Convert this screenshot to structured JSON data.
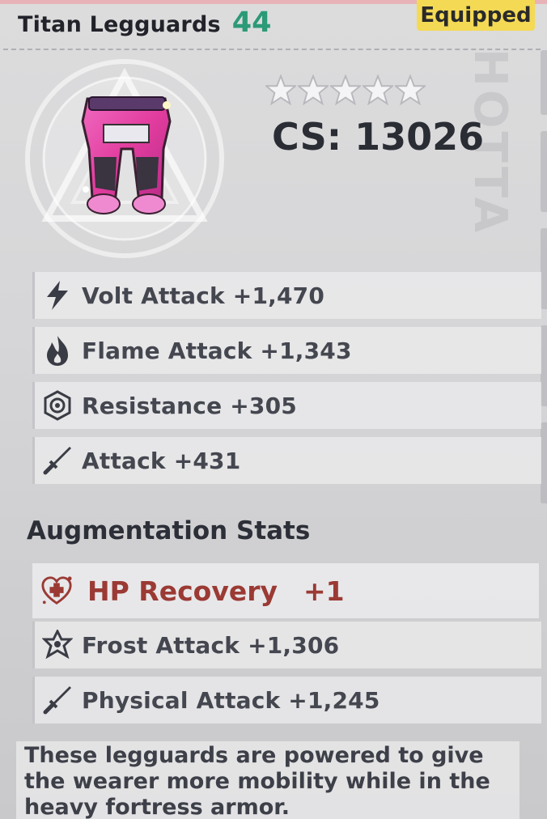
{
  "item": {
    "name": "Titan Legguards",
    "level": "44",
    "status": "Equipped"
  },
  "rating": {
    "stars_total": 5,
    "stars_filled": 0,
    "cs": "CS: 13026"
  },
  "base_stats": [
    {
      "icon": "volt-icon",
      "label": "Volt Attack +1,470"
    },
    {
      "icon": "flame-icon",
      "label": "Flame Attack +1,343"
    },
    {
      "icon": "resistance-icon",
      "label": "Resistance +305"
    },
    {
      "icon": "sword-icon",
      "label": "Attack +431"
    }
  ],
  "augmentation": {
    "title": "Augmentation Stats",
    "highlight": {
      "icon": "heart-plus-icon",
      "label": "HP Recovery",
      "value": "+1"
    },
    "stats": [
      {
        "icon": "frost-icon",
        "label": "Frost Attack +1,306"
      },
      {
        "icon": "sword-icon",
        "label": "Physical Attack +1,245"
      }
    ]
  },
  "description": "These legguards are powered to give the wearer more mobility while in the heavy fortress armor.",
  "colors": {
    "level": "#2b9a76",
    "equipped_badge": "#f4d955",
    "hp_recovery": "#9b3a34"
  }
}
